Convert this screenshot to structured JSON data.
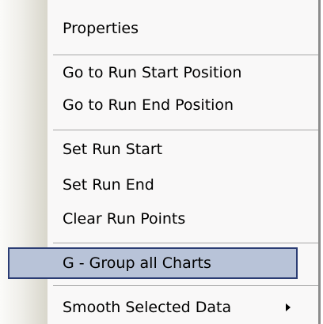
{
  "context_menu": {
    "items": [
      {
        "label": "Properties"
      },
      {
        "label": "Go to Run Start Position"
      },
      {
        "label": "Go to Run End Position"
      },
      {
        "label": "Set Run Start"
      },
      {
        "label": "Set Run End"
      },
      {
        "label": "Clear Run Points"
      },
      {
        "label": "G - Group all Charts",
        "highlighted": true
      },
      {
        "label": "Smooth Selected Data",
        "submenu_icon": "submenu-arrow-icon"
      }
    ]
  }
}
